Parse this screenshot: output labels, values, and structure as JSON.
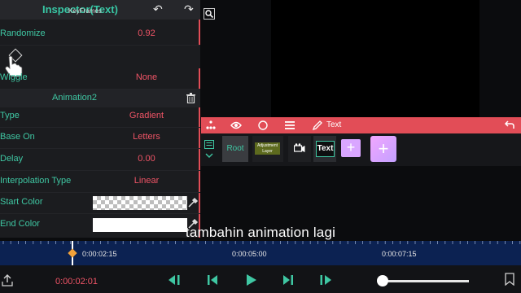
{
  "inspector": {
    "title": "Inspector(Text)",
    "randomize": {
      "label": "Randomize",
      "value": "0.92"
    },
    "keyframes_label": "KeyFrames",
    "wiggle": {
      "label": "Wiggle",
      "value": "None"
    },
    "animation_title": "Animation2",
    "rows": [
      {
        "label": "Type",
        "value": "Gradient"
      },
      {
        "label": "Base On",
        "value": "Letters"
      },
      {
        "label": "Delay",
        "value": "0.00"
      },
      {
        "label": "Interpolation Type",
        "value": "Linear"
      }
    ],
    "start_color_label": "Start Color",
    "end_color_label": "End Color"
  },
  "toolbar": {
    "text_label": "Text"
  },
  "layers": {
    "root": "Root",
    "adjustment": "Adjustment Layer",
    "text": "Text",
    "add_small": "+",
    "add_big": "+"
  },
  "subtitle": "tambahin animation lagi",
  "ruler": {
    "labels": [
      "0:00:02:15",
      "0:00:05:00",
      "0:00:07:15"
    ]
  },
  "transport": {
    "current_time": "0:00:02:01"
  },
  "colors": {
    "accent": "#3fc7a3",
    "value_red": "#ef5466",
    "toolbar_red": "#e24d57",
    "ruler_blue": "#0c2252"
  },
  "icons": [
    "undo-icon",
    "redo-icon",
    "zoom-icon",
    "keyframe-diamond-icon",
    "hand-pointer-icon",
    "trash-icon",
    "eyedropper-icon",
    "grid-icon",
    "eye-icon",
    "circle-icon",
    "menu-icon",
    "pencil-icon",
    "back-arrow-icon",
    "layer-menu-icon",
    "camera-icon",
    "skip-back-icon",
    "step-back-icon",
    "play-icon",
    "step-forward-icon",
    "skip-forward-icon",
    "export-icon",
    "bookmark-icon"
  ]
}
